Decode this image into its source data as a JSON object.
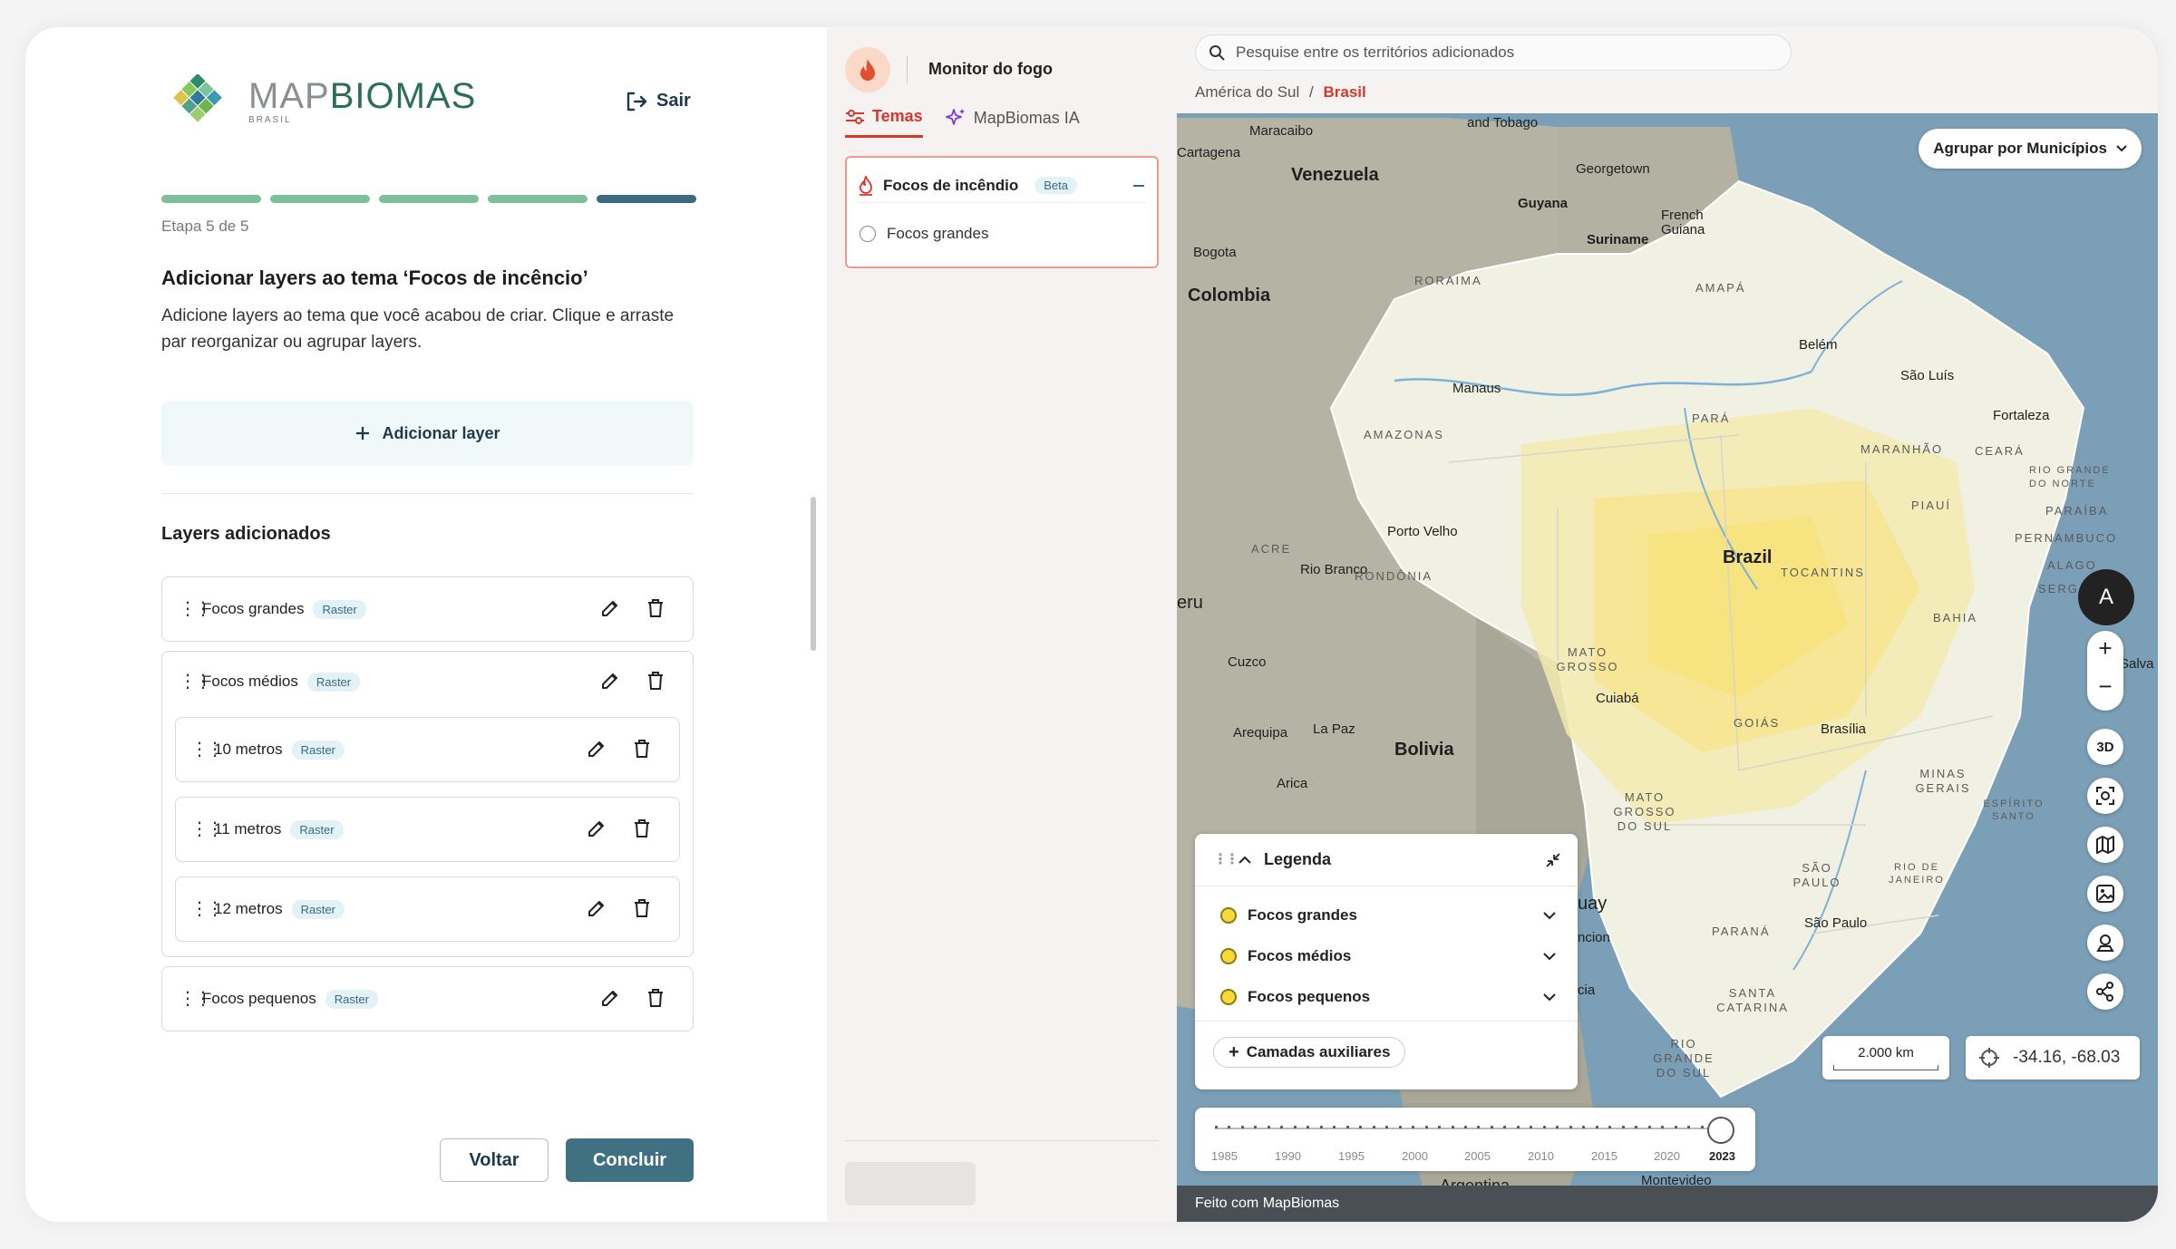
{
  "wizard": {
    "logo_main": "MAP",
    "logo_accent": "BIOMAS",
    "logo_sub": "BRASIL",
    "logout_label": "Sair",
    "step_label": "Etapa 5 de 5",
    "title": "Adicionar layers ao tema ‘Focos de incêncio’",
    "description": "Adicione layers ao tema que você acabou de criar. Clique e arraste par reorganizar ou agrupar layers.",
    "add_layer_label": "Adicionar layer",
    "added_heading": "Layers adicionados",
    "raster_badge": "Raster",
    "layers": [
      {
        "name": "Focos grandes",
        "type": "Raster"
      },
      {
        "name": "Focos médios",
        "type": "Raster",
        "children": [
          {
            "name": "10 metros",
            "type": "Raster"
          },
          {
            "name": "11 metros",
            "type": "Raster"
          },
          {
            "name": "12 metros",
            "type": "Raster"
          }
        ]
      },
      {
        "name": "Focos pequenos",
        "type": "Raster"
      }
    ],
    "back_label": "Voltar",
    "finish_label": "Concluir",
    "colors": {
      "accent": "#3f7183",
      "progress": "#7fbf9a",
      "progress_active": "#3d6a80"
    }
  },
  "panel": {
    "app_title": "Monitor do fogo",
    "tabs": [
      {
        "label": "Temas",
        "active": true
      },
      {
        "label": "MapBiomas IA",
        "active": false
      }
    ],
    "theme_title": "Focos de incêndio",
    "theme_badge": "Beta",
    "theme_item": "Focos grandes",
    "accent": "#d9362a"
  },
  "map": {
    "search_placeholder": "Pesquise entre os territórios adicionados",
    "breadcrumb_parent": "América do Sul",
    "breadcrumb_sep": "/",
    "breadcrumb_current": "Brasil",
    "group_by_label": "Agrupar por Municípios",
    "labels": {
      "venezuela": "Venezuela",
      "colombia": "Colombia",
      "guyana": "Guyana",
      "suriname": "Suriname",
      "french_guiana": "French Guiana",
      "georgetown": "Georgetown",
      "maracaibo": "Maracaibo",
      "cartagena": "Cartagena",
      "bogota": "Bogota",
      "trinidad": "and Tobago",
      "brazil": "Brazil",
      "bolivia": "Bolivia",
      "argentina": "Argentina",
      "manaus": "Manaus",
      "belem": "Belém",
      "sao_luis": "São Luís",
      "fortaleza": "Fortaleza",
      "porto_velho": "Porto Velho",
      "rio_branco": "Rio Branco",
      "cuzco": "Cuzco",
      "arequipa": "Arequipa",
      "la_paz": "La Paz",
      "arica": "Arica",
      "cuiaba": "Cuiabá",
      "brasilia": "Brasília",
      "sao_paulo": "São Paulo",
      "salvador": "Salva",
      "montevideo": "Montevideo",
      "peru": "eru",
      "paraguay": "uay",
      "asuncion": "ncion",
      "roraima": "RORAIMA",
      "amapa": "AMAPÁ",
      "amazonas": "AMAZONAS",
      "para": "PARÁ",
      "maranhao": "MARANHÃO",
      "ceara": "CEARÁ",
      "rio_grande_norte": "RIO GRANDE DO NORTE",
      "piaui": "PIAUÍ",
      "paraiba": "PARAÍBA",
      "pernambuco": "PERNAMBUCO",
      "alagoas": "ALAGO",
      "sergipe": "SERG",
      "acre": "ACRE",
      "rondonia": "RONDÔNIA",
      "tocantins": "TOCANTINS",
      "bahia": "BAHIA",
      "mato_grosso": "MATO GROSSO",
      "goias": "GOIÁS",
      "minas_gerais": "MINAS GERAIS",
      "mato_grosso_sul": "MATO GROSSO DO SUL",
      "espirito_santo": "ESPÍRITO SANTO",
      "sao_paulo_state": "SÃO PAULO",
      "rio_janeiro": "RIO DE JANEIRO",
      "parana": "PARANÁ",
      "santa_catarina": "SANTA CATARINA",
      "rio_grande_sul": "RIO GRANDE DO SUL",
      "bolivia_cia": "cia"
    },
    "controls": {
      "nav": "A",
      "zoom_in": "+",
      "zoom_out": "−",
      "three_d": "3D"
    },
    "scale": "2.000 km",
    "coords": "-34.16, -68.03",
    "legend": {
      "title": "Legenda",
      "items": [
        "Focos grandes",
        "Focos médios",
        "Focos pequenos"
      ],
      "aux_label": "Camadas auxiliares",
      "marker_color": "#f7d93a"
    },
    "timeline": {
      "years": [
        "1985",
        "1990",
        "1995",
        "2000",
        "2005",
        "2010",
        "2015",
        "2020",
        "2023"
      ],
      "selected": "2023"
    },
    "footer": "Feito com MapBiomas",
    "colors": {
      "water": "#7b9fb6",
      "land": "#f2f3e3",
      "fire": "#f5e27a"
    }
  }
}
